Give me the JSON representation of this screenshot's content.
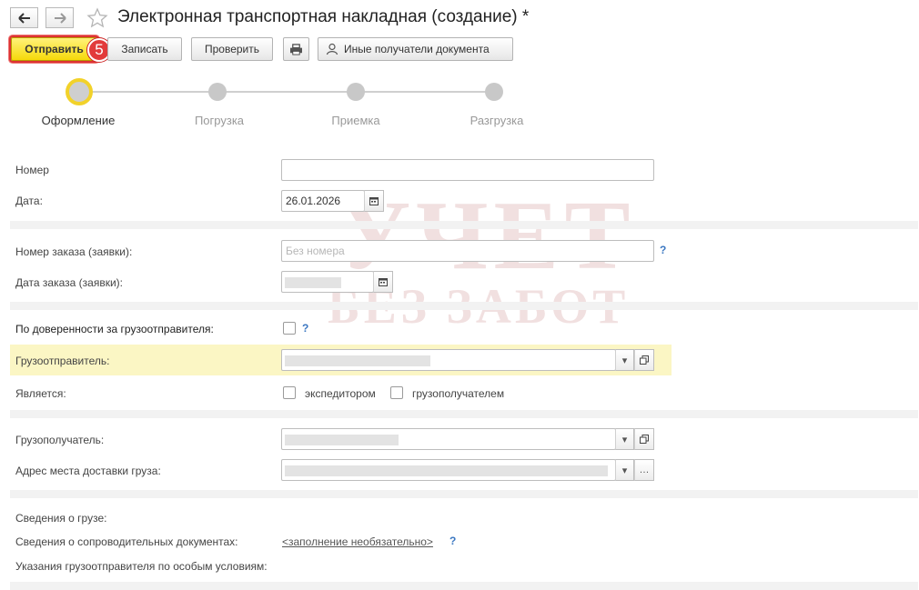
{
  "window": {
    "title": "Электронная транспортная накладная (создание) *"
  },
  "toolbar": {
    "send_label": "Отправить",
    "step_badge": "5",
    "save_label": "Записать",
    "check_label": "Проверить",
    "other_recipients_label": "Иные получатели документа"
  },
  "stepper": {
    "steps": [
      {
        "label": "Оформление",
        "active": true
      },
      {
        "label": "Погрузка",
        "active": false
      },
      {
        "label": "Приемка",
        "active": false
      },
      {
        "label": "Разгрузка",
        "active": false
      }
    ]
  },
  "form": {
    "number_label": "Номер",
    "number_value": "",
    "date_label": "Дата:",
    "date_value": "26.01.2026",
    "order_number_label": "Номер заказа (заявки):",
    "order_number_placeholder": "Без номера",
    "order_date_label": "Дата заказа (заявки):",
    "power_of_attorney_label": "По доверенности за грузоотправителя:",
    "shipper_label": "Грузоотправитель:",
    "is_label": "Является:",
    "forwarder_label": "экспедитором",
    "consignee_check_label": "грузополучателем",
    "consignee_label": "Грузополучатель:",
    "delivery_address_label": "Адрес места доставки груза:",
    "cargo_info_label": "Сведения о грузе:",
    "accompanying_docs_label": "Сведения о сопроводительных документах:",
    "accompanying_docs_link": "<заполнение необязательно>",
    "shipper_instructions_label": "Указания грузоотправителя по особым условиям:",
    "help_mark": "?"
  },
  "watermark": {
    "line1": "УЧЕТ",
    "line2": "БЕЗ ЗАБОТ"
  },
  "colors": {
    "primary_button": "#f5d90a",
    "highlight_row": "#fbf6c4",
    "help_blue": "#3c78c2",
    "active_step_ring": "#f2d22a",
    "badge_red": "#e23b3b"
  }
}
